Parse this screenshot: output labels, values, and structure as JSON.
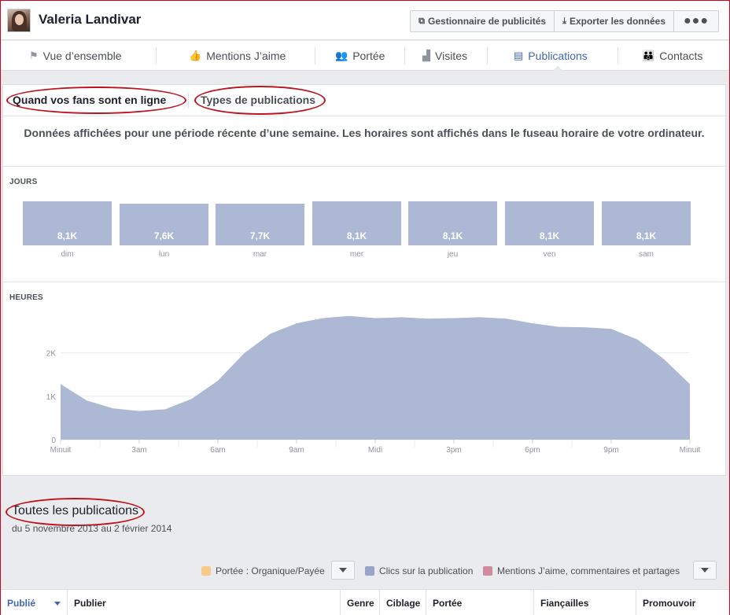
{
  "header": {
    "page_name": "Valeria Landivar",
    "buttons": {
      "ads_manager": "Gestionnaire de publicités",
      "export": "Exporter les données",
      "more": "●●●"
    }
  },
  "nav": {
    "tabs": [
      {
        "label": "Vue d’ensemble",
        "icon": "flag-icon"
      },
      {
        "label": "Mentions J’aime",
        "icon": "thumbs-up-icon"
      },
      {
        "label": "Portée",
        "icon": "people-icon"
      },
      {
        "label": "Visites",
        "icon": "bar-chart-icon"
      },
      {
        "label": "Publications",
        "icon": "posts-icon",
        "active": true
      },
      {
        "label": "Contacts",
        "icon": "group-icon"
      }
    ]
  },
  "subtabs": {
    "fans_online": "Quand vos fans sont en ligne",
    "post_types": "Types de publications"
  },
  "notice": "Données affichées pour une période récente d’une semaine. Les horaires sont affichés dans le fuseau horaire de votre ordinateur.",
  "days_label": "JOURS",
  "hours_label": "HEURES",
  "chart_data": [
    {
      "type": "bar",
      "title": "JOURS",
      "categories": [
        "dim",
        "lun",
        "mar",
        "mer",
        "jeu",
        "ven",
        "sam"
      ],
      "values": [
        8100,
        7600,
        7700,
        8100,
        8100,
        8100,
        8100
      ],
      "labels": [
        "8,1K",
        "7,6K",
        "7,7K",
        "8,1K",
        "8,1K",
        "8,1K",
        "8,1K"
      ]
    },
    {
      "type": "area",
      "title": "HEURES",
      "color": "#adb8d5",
      "x_ticks": [
        "Minuit",
        "3am",
        "6am",
        "9am",
        "Midi",
        "3pm",
        "6pm",
        "9pm",
        "Minuit"
      ],
      "y_ticks": [
        "0",
        "1K",
        "2K"
      ],
      "ylim": [
        0,
        2900
      ],
      "x": [
        0,
        1,
        2,
        3,
        4,
        5,
        6,
        7,
        8,
        9,
        10,
        11,
        12,
        13,
        14,
        15,
        16,
        17,
        18,
        19,
        20,
        21,
        22,
        23,
        24
      ],
      "values": [
        1280,
        900,
        720,
        660,
        700,
        940,
        1360,
        1990,
        2440,
        2680,
        2800,
        2850,
        2800,
        2820,
        2790,
        2800,
        2820,
        2790,
        2680,
        2600,
        2590,
        2550,
        2310,
        1860,
        1280
      ]
    }
  ],
  "publications": {
    "title": "Toutes les publications",
    "range": "du 5 novembre 2013 au 2 février 2014",
    "legend": [
      {
        "label": "Portée : Organique/Payée",
        "color": "#f7c98b"
      },
      {
        "label": "Clics sur la publication",
        "color": "#98a5c8"
      },
      {
        "label": "Mentions J’aime, commentaires et partages",
        "color": "#d08c9f"
      }
    ],
    "columns": [
      "Publié",
      "Publier",
      "Genre",
      "Ciblage",
      "Portée",
      "Fiançailles",
      "Promouvoir"
    ]
  }
}
